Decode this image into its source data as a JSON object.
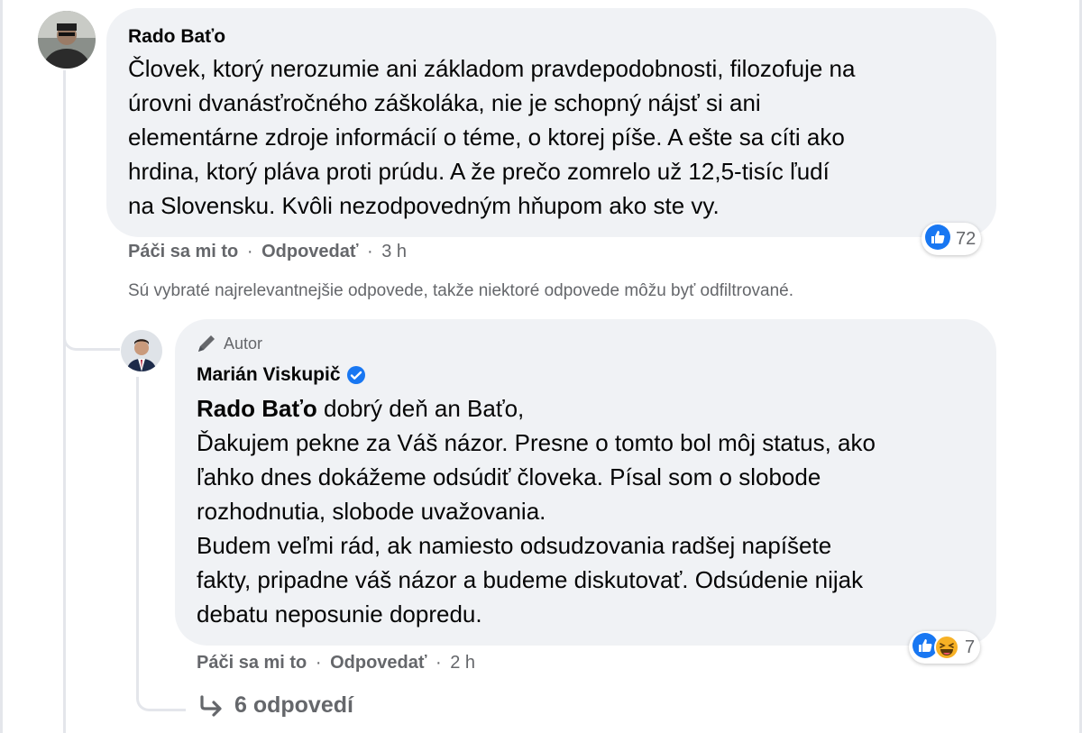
{
  "comment": {
    "author": "Rado Baťo",
    "text": "Človek, ktorý nerozumie ani základom pravdepodobnosti, filozofuje na\núrovni dvanásťročného záškoláka, nie je schopný nájsť si ani\nelementárne zdroje informácií o téme, o ktorej píše. A ešte sa cíti ako\nhrdina, ktorý pláva proti prúdu. A že prečo zomrelo už 12,5-tisíc ľudí\nna Slovensku. Kvôli nezodpovedným hňupom ako ste vy.",
    "like_label": "Páči sa mi to",
    "reply_label": "Odpovedať",
    "separator": "·",
    "time": "3 h",
    "reaction_icons": [
      "like-icon"
    ],
    "reaction_count": "72"
  },
  "filter_note": "Sú vybraté najrelevantnejšie odpovede, takže niektoré odpovede môžu byť odfiltrované.",
  "reply": {
    "badge_label": "Autor",
    "author": "Marián Viskupič",
    "verified": true,
    "mention": "Rado Baťo",
    "text_after_mention": " dobrý deň an Baťo,",
    "text": "Ďakujem pekne za Váš názor. Presne o tomto bol môj status, ako\nľahko dnes dokážeme odsúdiť človeka. Písal som o slobode\nrozhodnutia, slobode uvažovania.\nBudem veľmi rád, ak namiesto odsudzovania radšej napíšete\nfakty, pripadne váš názor a budeme diskutovať. Odsúdenie nijak\ndebatu neposunie dopredu.",
    "like_label": "Páči sa mi to",
    "reply_label": "Odpovedať",
    "separator": "·",
    "time": "2 h",
    "reaction_icons": [
      "like-icon",
      "laugh-icon"
    ],
    "reaction_count": "7"
  },
  "more_replies": {
    "icon": "reply-arrow-icon",
    "label": "6 odpovedí"
  },
  "colors": {
    "bubble": "#f0f2f5",
    "meta": "#65676b",
    "like_blue": "#1877f2",
    "verified_blue": "#1877f2",
    "haha_yellow": "#f7b125"
  }
}
